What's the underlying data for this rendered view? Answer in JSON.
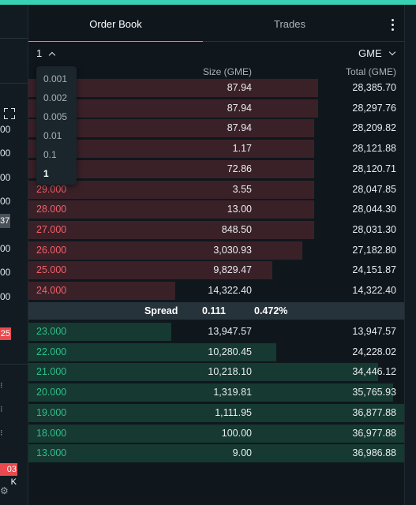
{
  "tabs": [
    {
      "label": "Order Book",
      "active": true
    },
    {
      "label": "Trades",
      "active": false
    }
  ],
  "precision": {
    "selected": "1",
    "options": [
      "0.001",
      "0.002",
      "0.005",
      "0.01",
      "0.1",
      "1"
    ]
  },
  "asset_selector": {
    "label": "GME"
  },
  "columns": {
    "size": "Size (GME)",
    "total": "Total (GME)"
  },
  "asks": [
    {
      "price": "",
      "size": "87.94",
      "total": "28,385.70",
      "depth": 0.77
    },
    {
      "price": "",
      "size": "87.94",
      "total": "28,297.76",
      "depth": 0.77
    },
    {
      "price": "",
      "size": "87.94",
      "total": "28,209.82",
      "depth": 0.76
    },
    {
      "price": "",
      "size": "1.17",
      "total": "28,121.88",
      "depth": 0.76
    },
    {
      "price": "",
      "size": "72.86",
      "total": "28,120.71",
      "depth": 0.76
    },
    {
      "price": "29.000",
      "size": "3.55",
      "total": "28,047.85",
      "depth": 0.76
    },
    {
      "price": "28.000",
      "size": "13.00",
      "total": "28,044.30",
      "depth": 0.76
    },
    {
      "price": "27.000",
      "size": "848.50",
      "total": "28,031.30",
      "depth": 0.76
    },
    {
      "price": "26.000",
      "size": "3,030.93",
      "total": "27,182.80",
      "depth": 0.73
    },
    {
      "price": "25.000",
      "size": "9,829.47",
      "total": "24,151.87",
      "depth": 0.65
    },
    {
      "price": "24.000",
      "size": "14,322.40",
      "total": "14,322.40",
      "depth": 0.39
    }
  ],
  "spread": {
    "label": "Spread",
    "value": "0.111",
    "percent": "0.472%"
  },
  "bids": [
    {
      "price": "23.000",
      "size": "13,947.57",
      "total": "13,947.57",
      "depth": 0.38
    },
    {
      "price": "22.000",
      "size": "10,280.45",
      "total": "24,228.02",
      "depth": 0.66
    },
    {
      "price": "21.000",
      "size": "10,218.10",
      "total": "34,446.12",
      "depth": 0.93
    },
    {
      "price": "20.000",
      "size": "1,319.81",
      "total": "35,765.93",
      "depth": 0.97
    },
    {
      "price": "19.000",
      "size": "1,111.95",
      "total": "36,877.88",
      "depth": 1.0
    },
    {
      "price": "18.000",
      "size": "100.00",
      "total": "36,977.88",
      "depth": 1.0
    },
    {
      "price": "13.000",
      "size": "9.00",
      "total": "36,986.88",
      "depth": 1.0
    }
  ],
  "left_panel": {
    "values": [
      "00",
      "00",
      "00",
      "00",
      "00",
      "00",
      "00"
    ],
    "highlight_badge": "25",
    "dark_badge": "37",
    "volume_badge": "03 K"
  },
  "colors": {
    "accent": "#39d1b4",
    "ask_price": "#f0606a",
    "bid_price": "#2fbf8a",
    "ask_bar": "#3a2128",
    "bid_bar": "#163931",
    "background": "#0f171d"
  },
  "icons": [
    "expand-icon",
    "more-options-icon",
    "chevron-up-icon",
    "chevron-down-icon",
    "settings-icon"
  ]
}
